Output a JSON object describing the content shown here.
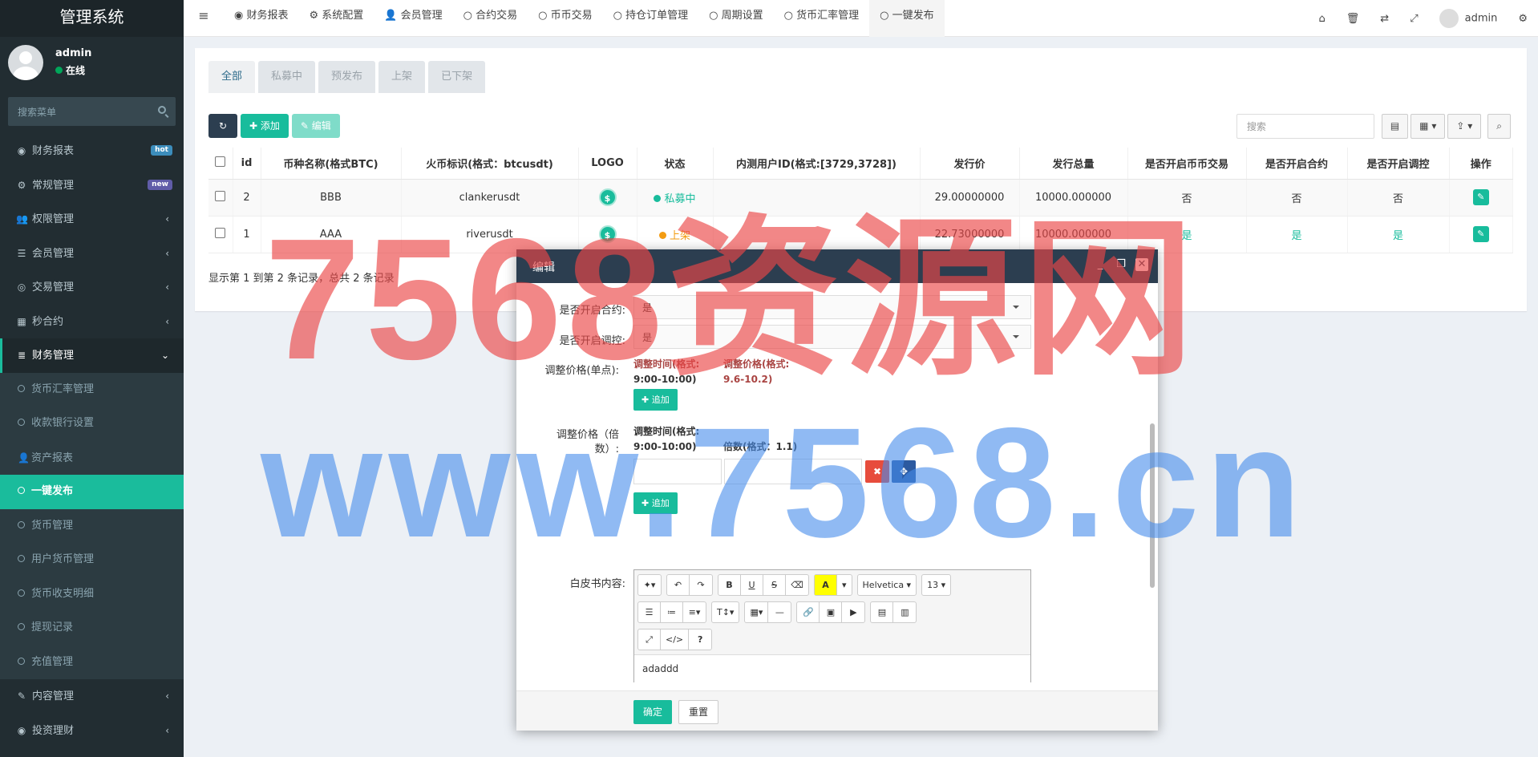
{
  "app": {
    "title": "管理系统",
    "user": "admin",
    "status": "在线",
    "search_placeholder": "搜索菜单"
  },
  "sidebar": {
    "items": [
      {
        "label": "财务报表",
        "icon": "dashboard-icon",
        "badge": "hot",
        "badge_color": "#3c8dbc"
      },
      {
        "label": "常规管理",
        "icon": "cogs-icon",
        "badge": "new",
        "badge_color": "#605ca8"
      },
      {
        "label": "权限管理",
        "icon": "group-icon"
      },
      {
        "label": "会员管理",
        "icon": "list-icon"
      },
      {
        "label": "交易管理",
        "icon": "eye-icon"
      },
      {
        "label": "秒合约",
        "icon": "calendar-icon"
      },
      {
        "label": "财务管理",
        "icon": "database-icon"
      }
    ],
    "sub_items": [
      "货币汇率管理",
      "收款银行设置",
      "资产报表",
      "一键发布",
      "货币管理",
      "用户货币管理",
      "货币收支明细",
      "提现记录",
      "充值管理"
    ],
    "bottom_items": [
      {
        "label": "内容管理",
        "icon": "pencil-icon"
      },
      {
        "label": "投资理财",
        "icon": "dashboard-icon"
      }
    ]
  },
  "topnav": {
    "tabs": [
      "财务报表",
      "系统配置",
      "会员管理",
      "合约交易",
      "币币交易",
      "持仓订单管理",
      "周期设置",
      "货币汇率管理",
      "一键发布"
    ],
    "user": "admin"
  },
  "content": {
    "status_tabs": [
      "全部",
      "私募中",
      "预发布",
      "上架",
      "已下架"
    ],
    "toolbar": {
      "add": "添加",
      "edit": "编辑"
    },
    "search_placeholder": "搜索",
    "table": {
      "columns": [
        "id",
        "币种名称(格式BTC)",
        "火币标识(格式：btcusdt)",
        "LOGO",
        "状态",
        "内测用户ID(格式:[3729,3728])",
        "发行价",
        "发行总量",
        "是否开启币币交易",
        "是否开启合约",
        "是否开启调控",
        "操作"
      ],
      "rows": [
        {
          "id": "2",
          "name": "BBB",
          "huobi": "clankerusdt",
          "logo": "$",
          "status": "私募中",
          "status_color": "#18bc9c",
          "test_ids": "",
          "price": "29.00000000",
          "total": "10000.000000",
          "coin_trade": "否",
          "contract": "否",
          "control": "否"
        },
        {
          "id": "1",
          "name": "AAA",
          "huobi": "riverusdt",
          "logo": "$",
          "status": "上架",
          "status_color": "#f39c12",
          "test_ids": "",
          "price": "22.73000000",
          "total": "10000.000000",
          "coin_trade": "是",
          "contract": "是",
          "control": "是"
        }
      ]
    },
    "pageinfo": "显示第 1 到第 2 条记录，总共 2 条记录"
  },
  "watermark": {
    "line1": "7568资源网",
    "line2": "www.7568.cn"
  },
  "modal": {
    "title": "编辑",
    "fields": {
      "contract_label": "是否开启合约:",
      "contract_value": "是",
      "control_label": "是否开启调控:",
      "control_value": "是",
      "price_single_label": "调整价格(单点):",
      "time_header_1": "调整时间(格式:",
      "time_header_1b": "9:00-10:00)",
      "price_header": "调整价格(格式:",
      "price_header_b": "9.6-10.2)",
      "add": "追加",
      "price_multi_label_a": "调整价格（倍",
      "price_multi_label_b": "数）:",
      "time_header_2": "调整时间(格式:",
      "time_header_2b": "9:00-10:00)",
      "multiple_header": "倍数(格式：1.1)",
      "whitepaper_label": "白皮书内容:",
      "editor_font": "Helvetica",
      "editor_size": "13",
      "editor_content": "adaddd"
    },
    "ok": "确定",
    "reset": "重置"
  }
}
